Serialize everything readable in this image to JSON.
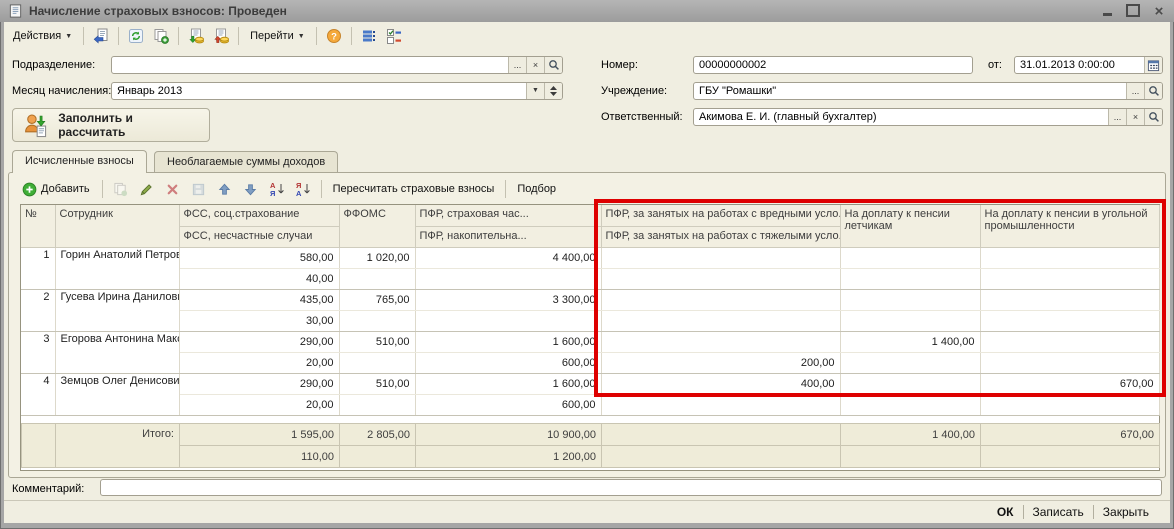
{
  "window": {
    "title": "Начисление страховых взносов: Проведен"
  },
  "main_toolbar": {
    "actions_label": "Действия",
    "goto_label": "Перейти",
    "help_glyph": "?"
  },
  "glyphs": {
    "menu_arrow": "▼",
    "ellipsis": "...",
    "clear": "×",
    "dropdown": "▼"
  },
  "header_form": {
    "department": {
      "label": "Подразделение:",
      "value": ""
    },
    "accrual_month": {
      "label": "Месяц начисления:",
      "value": "Январь 2013"
    },
    "number": {
      "label": "Номер:",
      "value": "00000000002"
    },
    "date": {
      "label": "от:",
      "value": "31.01.2013 0:00:00"
    },
    "institution": {
      "label": "Учреждение:",
      "value": "ГБУ \"Ромашки\""
    },
    "responsible": {
      "label": "Ответственный:",
      "value": "Акимова Е. И. (главный бухгалтер)"
    },
    "fill_button": "Заполнить и рассчитать"
  },
  "tabs": {
    "calculated": "Исчисленные взносы",
    "nontaxable": "Необлагаемые суммы доходов"
  },
  "grid_toolbar": {
    "add_hotkey": "Д",
    "add_rest": "обавить",
    "recalculate": "Пересчитать страховые взносы",
    "pick": "Подбор"
  },
  "grid": {
    "columns": {
      "num": "№",
      "employee": "Сотрудник",
      "fss_top": "ФСС, соц.страхование",
      "fss_bottom": "ФСС, несчастные случаи",
      "ffoms": "ФФОМС",
      "pfr_top": "ПФР, страховая час...",
      "pfr_bottom": "ПФР, накопительна...",
      "harm_top": "ПФР, за занятых на работах с вредными усло...",
      "harm_bottom": "ПФР, за занятых на работах с тяжелыми усло...",
      "pilots": "На доплату к пенсии летчикам",
      "coal": "На доплату к пенсии в угольной промышленности"
    },
    "rows": [
      {
        "num": "1",
        "employee": "Горин Анатолий Петрович",
        "fss": "580,00",
        "fss_ns": "40,00",
        "ffoms": "1 020,00",
        "pfr_ins": "4 400,00",
        "pfr_acc": "",
        "harm": "",
        "heavy": "",
        "pilots": "",
        "coal": ""
      },
      {
        "num": "2",
        "employee": "Гусева Ирина Даниловна",
        "fss": "435,00",
        "fss_ns": "30,00",
        "ffoms": "765,00",
        "pfr_ins": "3 300,00",
        "pfr_acc": "",
        "harm": "",
        "heavy": "",
        "pilots": "",
        "coal": ""
      },
      {
        "num": "3",
        "employee": "Егорова Антонина Максимовна",
        "fss": "290,00",
        "fss_ns": "20,00",
        "ffoms": "510,00",
        "pfr_ins": "1 600,00",
        "pfr_acc": "600,00",
        "harm": "",
        "heavy": "200,00",
        "pilots": "1 400,00",
        "coal": ""
      },
      {
        "num": "4",
        "employee": "Земцов Олег Денисович",
        "fss": "290,00",
        "fss_ns": "20,00",
        "ffoms": "510,00",
        "pfr_ins": "1 600,00",
        "pfr_acc": "600,00",
        "harm": "400,00",
        "heavy": "",
        "pilots": "",
        "coal": "670,00"
      }
    ],
    "totals": {
      "label": "Итого:",
      "fss": "1 595,00",
      "fss_ns": "110,00",
      "ffoms": "2 805,00",
      "pfr_ins": "10 900,00",
      "pfr_acc": "1 200,00",
      "harm": "",
      "heavy": "",
      "pilots": "1 400,00",
      "coal": "670,00"
    }
  },
  "comment": {
    "label": "Комментарий:",
    "value": ""
  },
  "footer": {
    "ok": "ОК",
    "save": "Записать",
    "close": "Закрыть"
  },
  "annotation": {
    "highlight_color": "#de0000"
  }
}
